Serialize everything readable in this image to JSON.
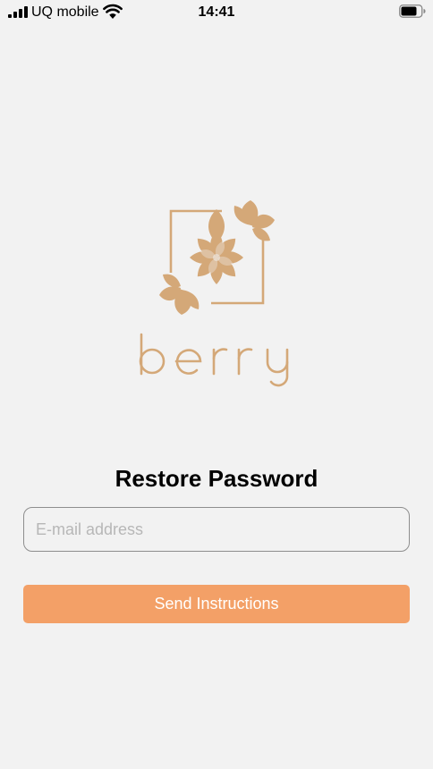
{
  "status_bar": {
    "carrier": "UQ mobile",
    "time": "14:41",
    "icons": [
      "signal-icon",
      "wifi-icon",
      "battery-icon"
    ]
  },
  "logo": {
    "wordmark": "berry",
    "icon": "lotus-flower-icon",
    "color": "#d4a878"
  },
  "page": {
    "title": "Restore Password"
  },
  "email": {
    "placeholder": "E-mail address",
    "value": ""
  },
  "send_button": {
    "label": "Send Instructions",
    "color": "#f3a067"
  },
  "colors": {
    "background": "#f2f2f2",
    "accent": "#f3a067",
    "brand": "#d4a878"
  }
}
